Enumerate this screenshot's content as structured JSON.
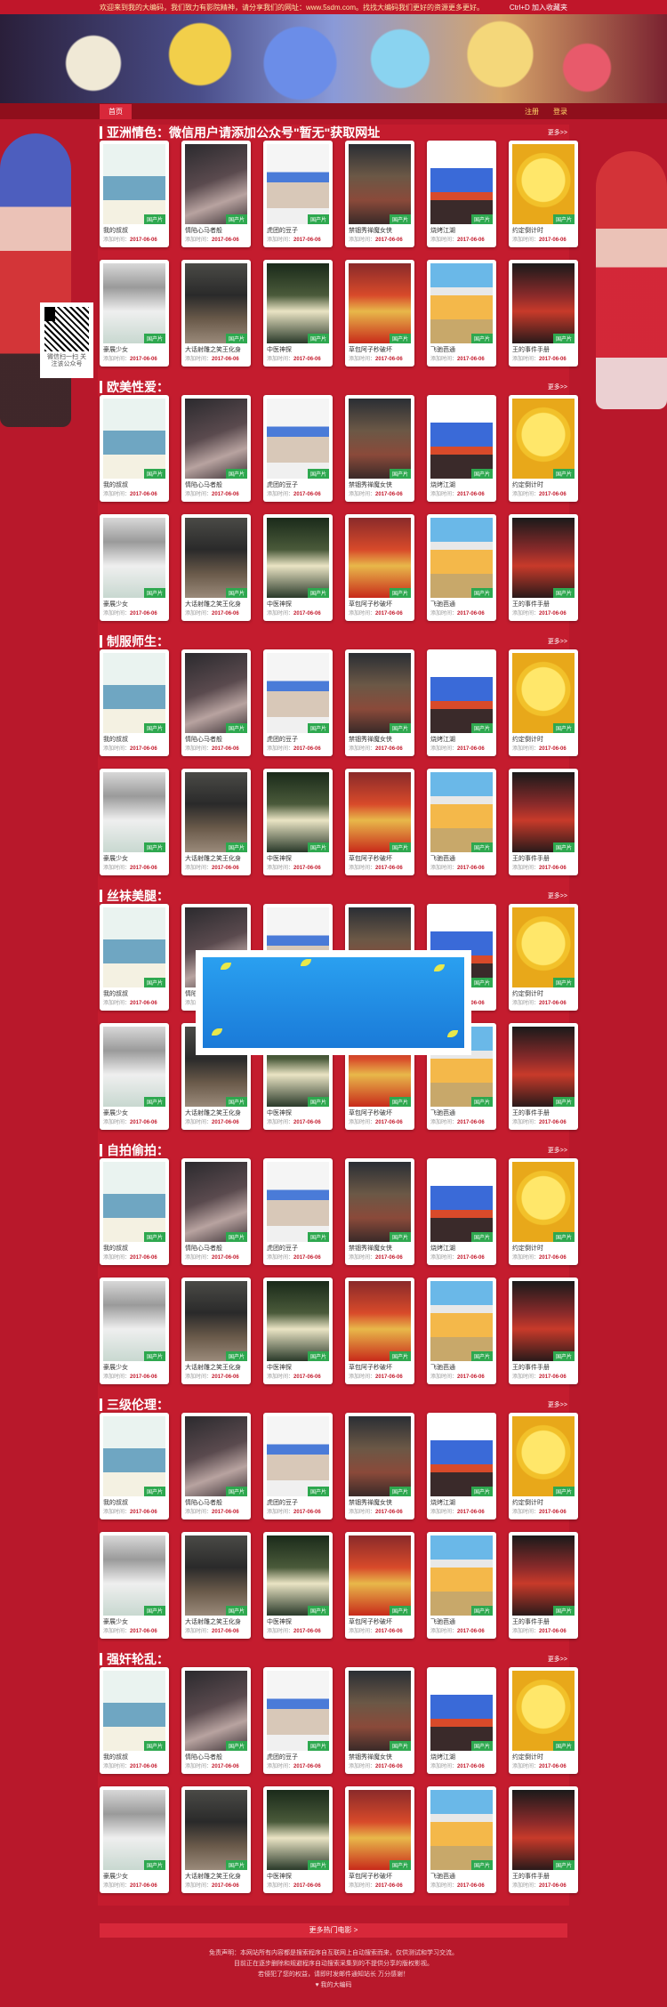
{
  "topbar": {
    "welcome": "欢迎来到我的大编码，我们致力有影院精神，请分享我们的网址：www.5sdm.com。找找大编码我们更好的资源更多更好。",
    "bookmark": "Ctrl+D 加入收藏夹"
  },
  "nav": {
    "home": "首页",
    "register": "注册",
    "login": "登录"
  },
  "qr": {
    "caption": "微信扫一扫 关注该公众号"
  },
  "more_label": "更多>>",
  "date_prefix": "添加时间：",
  "sections": [
    {
      "title": "亚洲情色：微信用户请添加公众号\"暂无\"获取网址"
    },
    {
      "title": "欧美性爱："
    },
    {
      "title": "制服师生："
    },
    {
      "title": "丝袜美腿："
    },
    {
      "title": "自拍偷拍："
    },
    {
      "title": "三级伦理："
    },
    {
      "title": "强奸轮乱："
    }
  ],
  "movies": [
    {
      "name": "我的叔叔",
      "date": "2017-06-06",
      "tag": "国产片"
    },
    {
      "name": "情陷心马者般",
      "date": "2017-06-06",
      "tag": "国产片"
    },
    {
      "name": "虎团的豆子",
      "date": "2017-06-06",
      "tag": "国产片"
    },
    {
      "name": "禁锢秀禅魔女侠",
      "date": "2017-06-06",
      "tag": "国产片"
    },
    {
      "name": "烧烤江湖",
      "date": "2017-06-06",
      "tag": "国产片"
    },
    {
      "name": "约定倒计时",
      "date": "2017-06-06",
      "tag": "国产片"
    },
    {
      "name": "豪展少女",
      "date": "2017-06-06",
      "tag": "国产片"
    },
    {
      "name": "大话射雕之笑王化身",
      "date": "2017-06-06",
      "tag": "国产片"
    },
    {
      "name": "中医神探",
      "date": "2017-06-06",
      "tag": "国产片"
    },
    {
      "name": "草包阿子秒破坏",
      "date": "2017-06-06",
      "tag": "国产片"
    },
    {
      "name": "飞驰芭通",
      "date": "2017-06-06",
      "tag": "国产片"
    },
    {
      "name": "王的事件手册",
      "date": "2017-06-06",
      "tag": "国产片"
    }
  ],
  "bottom": {
    "more_button": "更多热门电影 >",
    "footer_line1": "免责声明：本网站所有内容都是搜索程序自互联网上自动搜索而来，仅供测试和学习交流。",
    "footer_line2": "目前正在逐步删除和规避程序自动搜索采集到的不提供分享的版权影视。",
    "footer_line3": "若侵犯了您的权益，请即时发邮件通知站长 万分感谢！",
    "footer_line4": "♥ 我的大编码"
  }
}
